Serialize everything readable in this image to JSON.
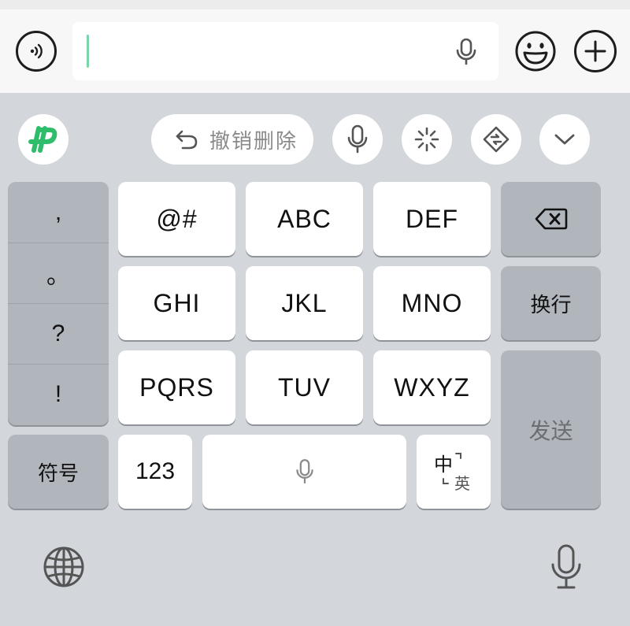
{
  "input_bar": {
    "text_value": "",
    "icons": {
      "voice": "voice-message-icon",
      "mic": "microphone-icon",
      "emoji": "emoji-icon",
      "plus": "plus-icon"
    }
  },
  "toolbar": {
    "logo_icon": "ime-logo-icon",
    "undo_label": "撤销删除",
    "icons": [
      "undo-icon",
      "microphone-icon",
      "sparkle-icon",
      "switch-keyboard-icon",
      "chevron-down-icon"
    ]
  },
  "keys": {
    "punctuation": [
      ",",
      "。",
      "?",
      "!"
    ],
    "row1": [
      "@#",
      "ABC",
      "DEF"
    ],
    "row2": [
      "GHI",
      "JKL",
      "MNO"
    ],
    "row3": [
      "PQRS",
      "TUV",
      "WXYZ"
    ],
    "symbols": "符号",
    "numbers": "123",
    "lang_main": "中",
    "lang_sub": "英",
    "newline": "换行",
    "send": "发送",
    "backspace_icon": "backspace-icon",
    "space_icon": "microphone-icon"
  },
  "bottom": {
    "globe_icon": "globe-icon",
    "dictation_icon": "microphone-icon"
  },
  "colors": {
    "accent_green": "#2ebd6b",
    "caret": "#7ad6a8",
    "key_white": "#ffffff",
    "key_gray": "#b1b5bc",
    "keyboard_bg": "#d3d6da"
  }
}
